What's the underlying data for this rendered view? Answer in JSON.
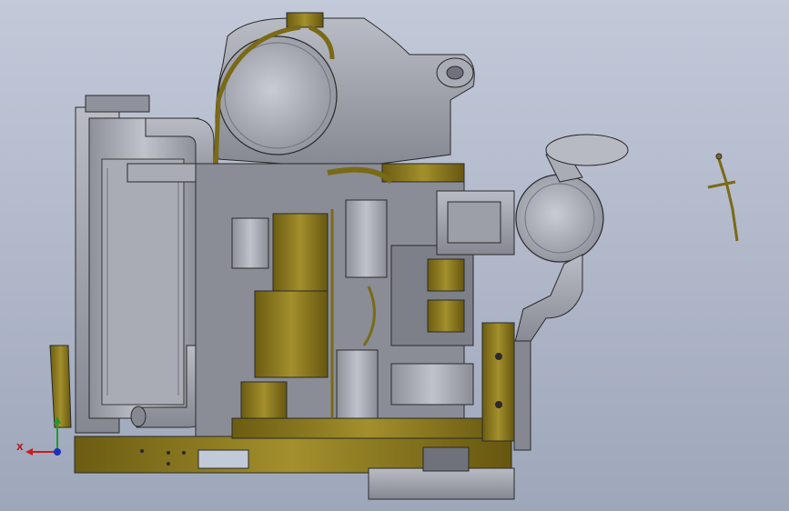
{
  "viewport": {
    "background_top": "#c2c9d9",
    "background_bottom": "#9ea7ba"
  },
  "model": {
    "colors": {
      "gray_part": "#9c9fa8",
      "gray_light": "#b7bac2",
      "gray_dark": "#6f727b",
      "yellow_part": "#7a6a18",
      "yellow_light": "#a08c2a",
      "outline": "#2a2a2a"
    }
  },
  "triad": {
    "x_label": "X",
    "y_label": "",
    "colors": {
      "x": "#c41e1e",
      "y": "#1f9b2e",
      "z": "#1b2fbf"
    },
    "icons": [
      "axis-triad-icon"
    ]
  }
}
